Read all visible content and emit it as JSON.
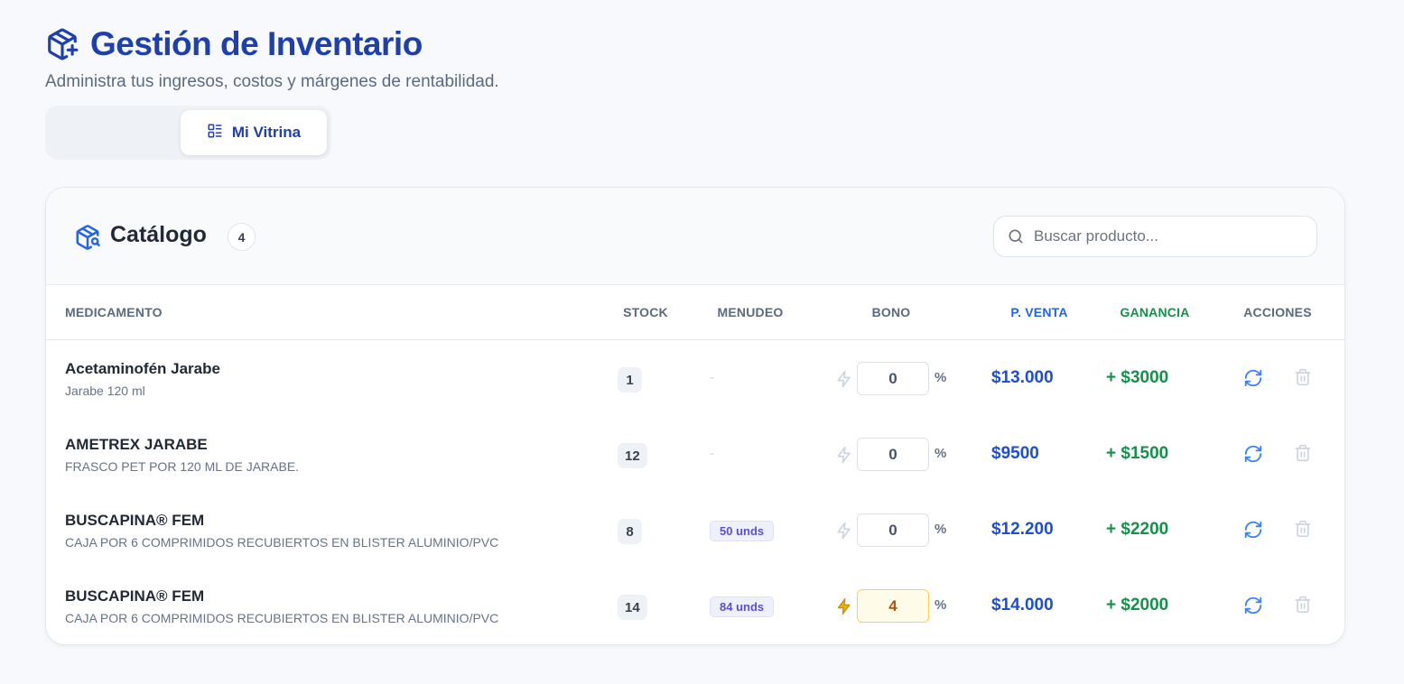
{
  "header": {
    "icon": "package-plus-icon",
    "title": "Gestión de Inventario",
    "subtitle": "Administra tus ingresos, costos y márgenes de rentabilidad."
  },
  "tabs": {
    "active_label": "Mi Vitrina",
    "active_icon": "layout-list-icon"
  },
  "catalog": {
    "icon": "package-search-icon",
    "title": "Catálogo",
    "count": "4",
    "search_placeholder": "Buscar producto...",
    "search_value": ""
  },
  "table": {
    "columns": [
      "MEDICAMENTO",
      "STOCK",
      "MENUDEO",
      "BONO",
      "P. VENTA",
      "GANANCIA",
      "ACCIONES"
    ],
    "rows": [
      {
        "name": "Acetaminofén Jarabe",
        "description": "Jarabe 120 ml",
        "stock": "1",
        "menudeo": "-",
        "bono": "0",
        "bono_active": false,
        "pct": "%",
        "precio_venta": "$13.000",
        "ganancia": "+ $3000"
      },
      {
        "name": "AMETREX JARABE",
        "description": "FRASCO PET POR 120 ML DE JARABE.",
        "stock": "12",
        "menudeo": "-",
        "bono": "0",
        "bono_active": false,
        "pct": "%",
        "precio_venta": "$9500",
        "ganancia": "+ $1500"
      },
      {
        "name": "BUSCAPINA® FEM",
        "description": "CAJA POR 6 COMPRIMIDOS RECUBIERTOS EN BLISTER ALUMINIO/PVC",
        "stock": "8",
        "menudeo": "50 unds",
        "bono": "0",
        "bono_active": false,
        "pct": "%",
        "precio_venta": "$12.200",
        "ganancia": "+ $2200"
      },
      {
        "name": "BUSCAPINA® FEM",
        "description": "CAJA POR 6 COMPRIMIDOS RECUBIERTOS EN BLISTER ALUMINIO/PVC",
        "stock": "14",
        "menudeo": "84 unds",
        "bono": "4",
        "bono_active": true,
        "pct": "%",
        "precio_venta": "$14.000",
        "ganancia": "+ $2000"
      }
    ]
  },
  "colors": {
    "title": "#1e40af",
    "price": "#1d4ed8",
    "profit": "#15904a",
    "action_icon": "#3b82f6",
    "bolt_inactive": "#cbd5e1",
    "bolt_active": "#eab308"
  }
}
